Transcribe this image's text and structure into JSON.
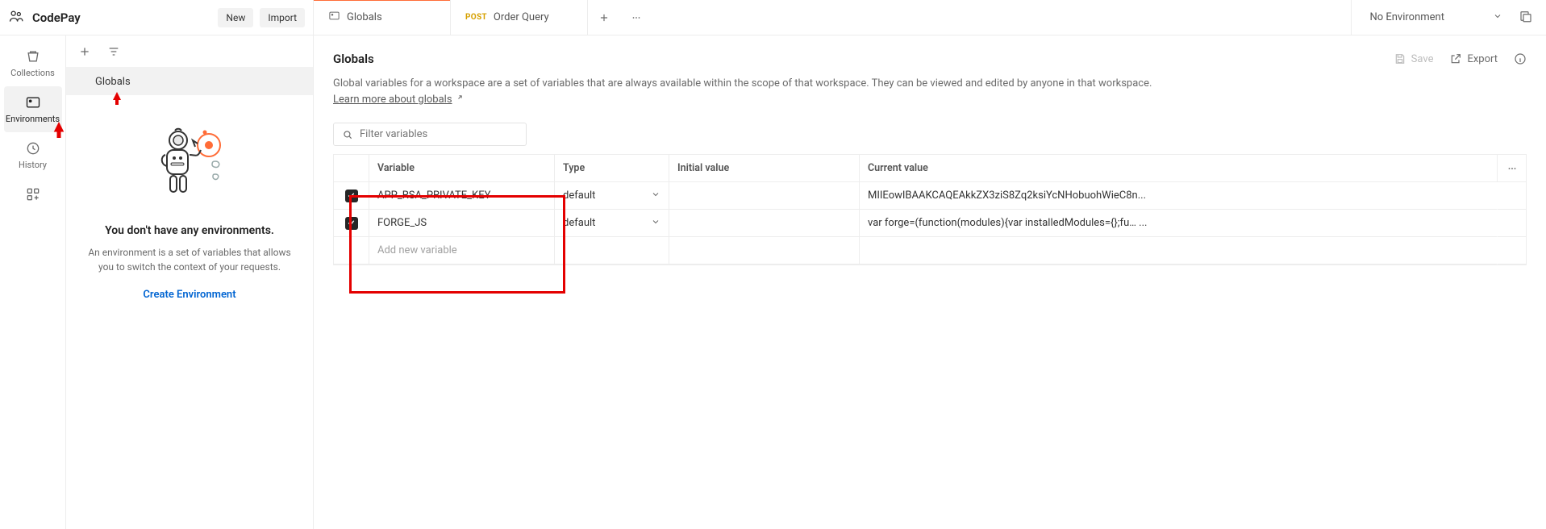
{
  "workspace": {
    "name": "CodePay"
  },
  "topbar": {
    "new_label": "New",
    "import_label": "Import"
  },
  "tabs": [
    {
      "kind": "globals",
      "label": "Globals",
      "active": true
    },
    {
      "kind": "request",
      "method": "POST",
      "label": "Order Query",
      "active": false
    }
  ],
  "env_selector": {
    "label": "No Environment"
  },
  "rail": [
    {
      "id": "collections",
      "label": "Collections"
    },
    {
      "id": "environments",
      "label": "Environments",
      "active": true
    },
    {
      "id": "history",
      "label": "History"
    }
  ],
  "sidebar": {
    "selected_item": "Globals",
    "empty_title": "You don't have any environments.",
    "empty_desc": "An environment is a set of variables that allows you to switch the context of your requests.",
    "create_label": "Create Environment"
  },
  "page": {
    "title": "Globals",
    "save_label": "Save",
    "export_label": "Export",
    "description": "Global variables for a workspace are a set of variables that are always available within the scope of that workspace. They can be viewed and edited by anyone in that workspace.",
    "learn_more": "Learn more about globals"
  },
  "filter": {
    "placeholder": "Filter variables"
  },
  "table": {
    "headers": {
      "variable": "Variable",
      "type": "Type",
      "initial": "Initial value",
      "current": "Current value"
    },
    "placeholder_text": "Add new variable",
    "rows": [
      {
        "checked": true,
        "variable": "APP_RSA_PRIVATE_KEY",
        "type": "default",
        "initial": "",
        "current": "MIIEowIBAAKCAQEAkkZX3ziS8Zq2ksiYcNHobuohWieC8n..."
      },
      {
        "checked": true,
        "variable": "FORGE_JS",
        "type": "default",
        "initial": "",
        "current": "var forge=(function(modules){var installedModules={};fu… ..."
      }
    ]
  }
}
